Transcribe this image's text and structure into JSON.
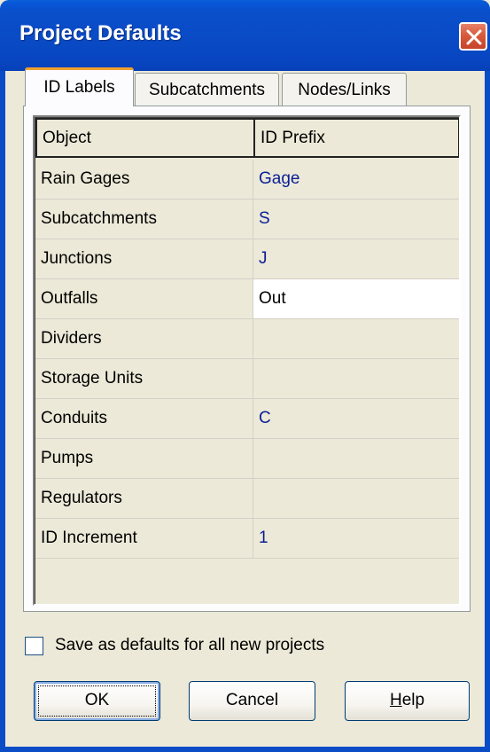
{
  "window": {
    "title": "Project Defaults"
  },
  "tabs": [
    {
      "label": "ID Labels",
      "active": true
    },
    {
      "label": "Subcatchments",
      "active": false
    },
    {
      "label": "Nodes/Links",
      "active": false
    }
  ],
  "grid": {
    "headers": {
      "object": "Object",
      "prefix": "ID Prefix"
    },
    "rows": [
      {
        "object": "Rain Gages",
        "prefix": "Gage"
      },
      {
        "object": "Subcatchments",
        "prefix": "S"
      },
      {
        "object": "Junctions",
        "prefix": "J"
      },
      {
        "object": "Outfalls",
        "prefix": "Out"
      },
      {
        "object": "Dividers",
        "prefix": ""
      },
      {
        "object": "Storage Units",
        "prefix": ""
      },
      {
        "object": "Conduits",
        "prefix": "C"
      },
      {
        "object": "Pumps",
        "prefix": ""
      },
      {
        "object": "Regulators",
        "prefix": ""
      },
      {
        "object": "ID Increment",
        "prefix": "1"
      }
    ]
  },
  "save_defaults": {
    "label": "Save as defaults for all new projects",
    "checked": false
  },
  "buttons": {
    "ok": "OK",
    "cancel": "Cancel",
    "help_mnemonic": "H",
    "help_rest": "elp"
  },
  "icons": {
    "close": "close-x-icon"
  },
  "colors": {
    "titlebar": "#0a4bc6",
    "active_tab_accent": "#f0a02f",
    "value_text": "#0a1e96"
  }
}
